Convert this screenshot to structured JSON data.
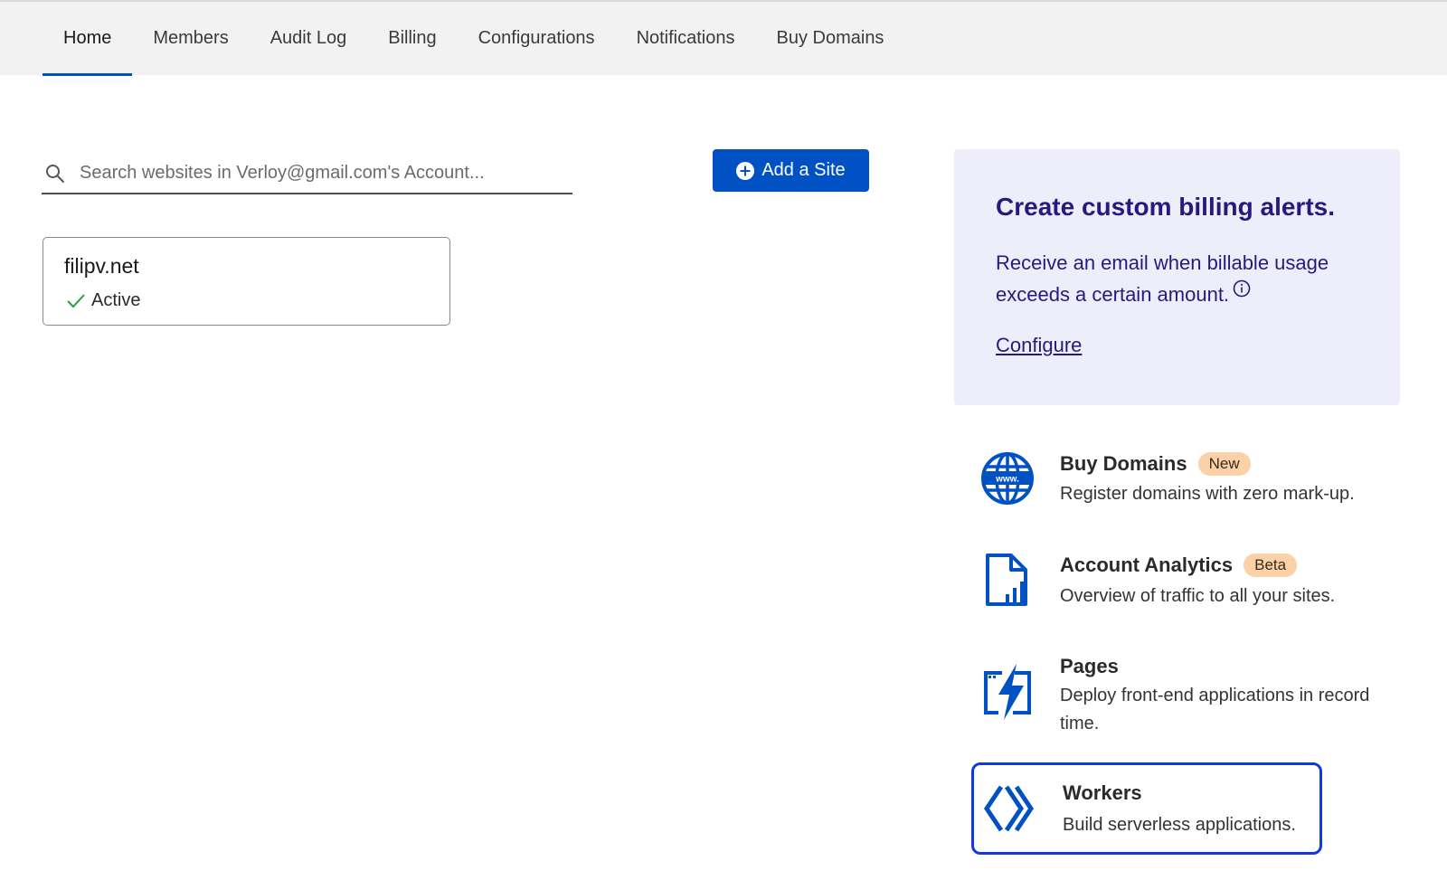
{
  "nav": {
    "tabs": [
      {
        "label": "Home",
        "active": true
      },
      {
        "label": "Members"
      },
      {
        "label": "Audit Log"
      },
      {
        "label": "Billing"
      },
      {
        "label": "Configurations"
      },
      {
        "label": "Notifications"
      },
      {
        "label": "Buy Domains"
      }
    ]
  },
  "search": {
    "placeholder": "Search websites in Verloy@gmail.com's Account...",
    "icon": "search-icon"
  },
  "add_site": {
    "label": "Add a Site",
    "icon": "plus-circle-icon"
  },
  "sites": [
    {
      "name": "filipv.net",
      "status": "Active",
      "status_icon": "check-icon"
    }
  ],
  "billing_alert": {
    "title": "Create custom billing alerts.",
    "text": "Receive an email when billable usage exceeds a certain amount.",
    "link": "Configure"
  },
  "features": [
    {
      "title": "Buy Domains",
      "badge": "New",
      "desc": "Register domains with zero mark-up.",
      "icon": "globe-www-icon"
    },
    {
      "title": "Account Analytics",
      "badge": "Beta",
      "desc": "Overview of traffic to all your sites.",
      "icon": "analytics-document-icon"
    },
    {
      "title": "Pages",
      "desc": "Deploy front-end applications in record time.",
      "icon": "pages-lightning-icon"
    },
    {
      "title": "Workers",
      "desc": "Build serverless applications.",
      "icon": "workers-icon"
    }
  ],
  "colors": {
    "accent": "#0051c3",
    "alert_bg": "#eeedfa",
    "alert_text": "#241a80",
    "badge_bg": "#fbd2a8",
    "highlight": "#1438e0"
  }
}
